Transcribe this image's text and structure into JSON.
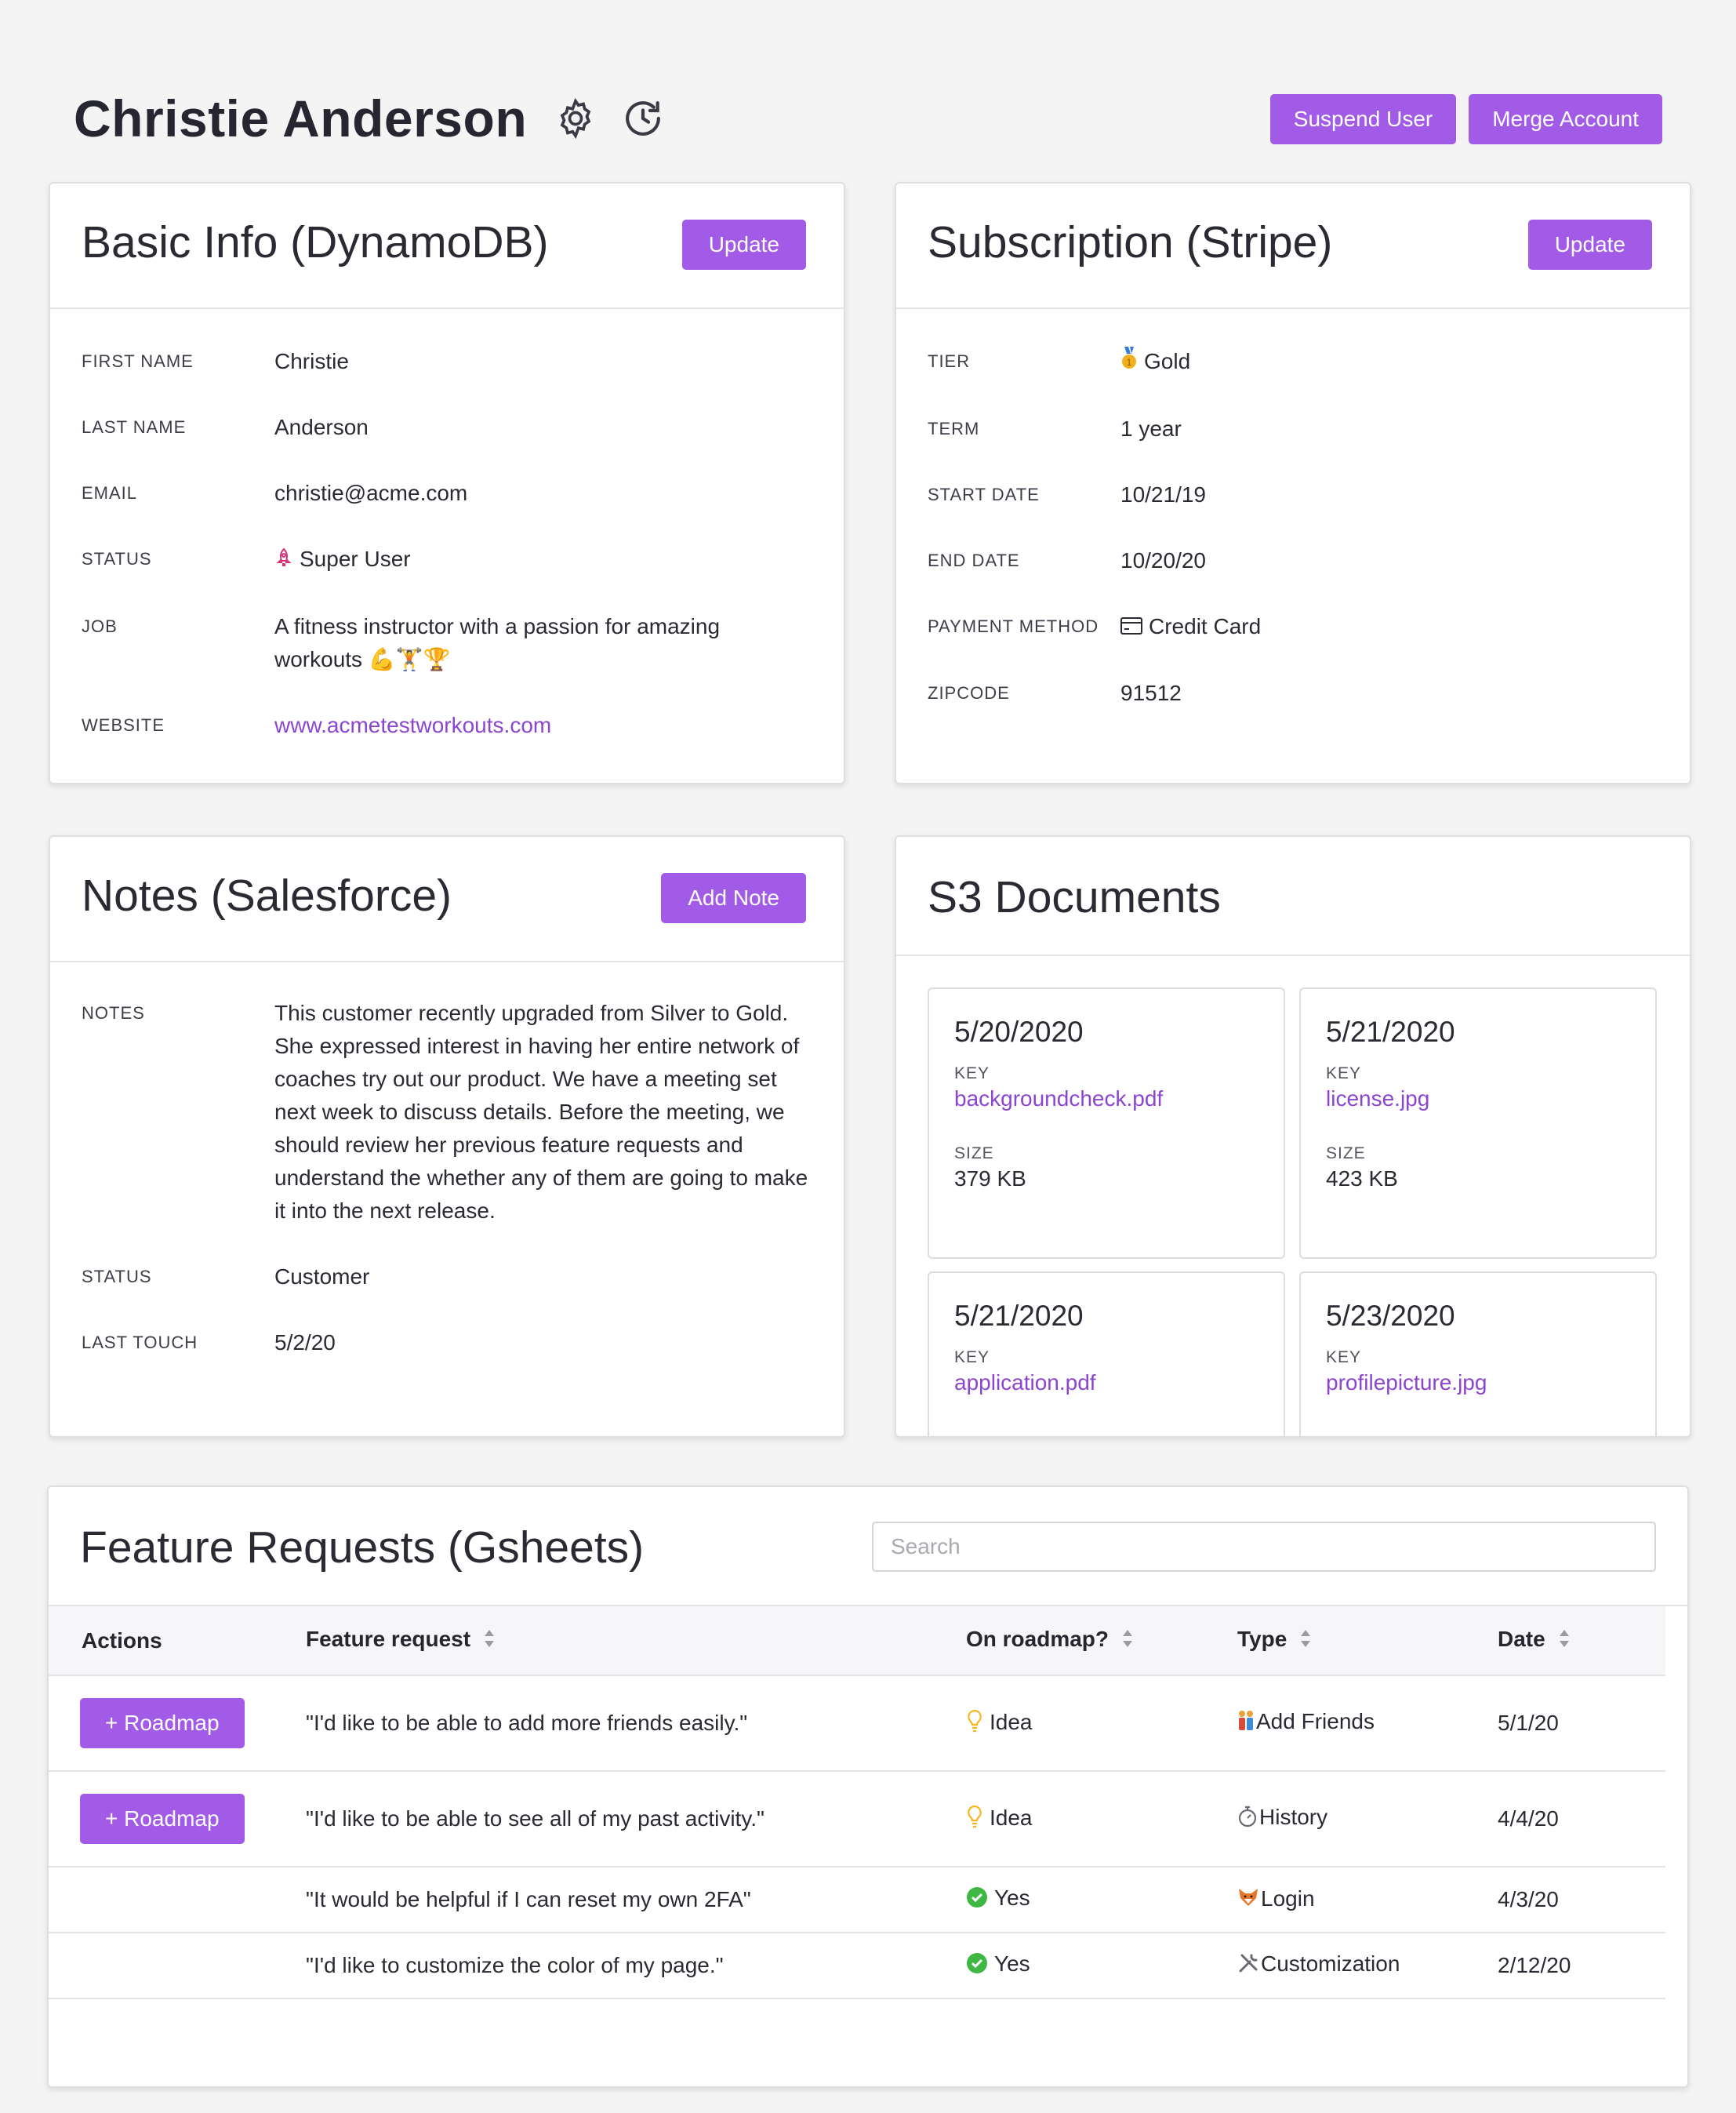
{
  "header": {
    "title": "Christie Anderson",
    "actions": {
      "suspend": "Suspend User",
      "merge": "Merge Account"
    }
  },
  "basic_info": {
    "title": "Basic Info (DynamoDB)",
    "update_label": "Update",
    "fields": {
      "first_name": {
        "label": "FIRST NAME",
        "value": "Christie"
      },
      "last_name": {
        "label": "LAST NAME",
        "value": "Anderson"
      },
      "email": {
        "label": "EMAIL",
        "value": "christie@acme.com"
      },
      "status": {
        "label": "STATUS",
        "value": "Super User",
        "icon": "rocket-icon"
      },
      "job": {
        "label": "JOB",
        "value": "A fitness instructor with a passion for amazing workouts 💪🏋️🏆"
      },
      "website": {
        "label": "WEBSITE",
        "value": "www.acmetestworkouts.com"
      }
    }
  },
  "subscription": {
    "title": "Subscription (Stripe)",
    "update_label": "Update",
    "fields": {
      "tier": {
        "label": "TIER",
        "value": "Gold",
        "icon": "gold-medal-icon"
      },
      "term": {
        "label": "TERM",
        "value": "1 year"
      },
      "start_date": {
        "label": "START DATE",
        "value": "10/21/19"
      },
      "end_date": {
        "label": "END DATE",
        "value": "10/20/20"
      },
      "payment_method": {
        "label": "PAYMENT METHOD",
        "value": "Credit Card",
        "icon": "credit-card-icon"
      },
      "zipcode": {
        "label": "ZIPCODE",
        "value": "91512"
      }
    }
  },
  "notes": {
    "title": "Notes (Salesforce)",
    "add_label": "Add Note",
    "fields": {
      "notes": {
        "label": "NOTES",
        "value": "This customer recently upgraded from Silver to Gold. She expressed interest in having her entire network of coaches try out our product. We have a meeting set next week to discuss details. Before the meeting, we should review her previous feature requests and understand the whether any of them are going to make it into the next release."
      },
      "status": {
        "label": "STATUS",
        "value": "Customer"
      },
      "last_touch": {
        "label": "LAST TOUCH",
        "value": "5/2/20"
      }
    }
  },
  "s3": {
    "title": "S3 Documents",
    "key_label": "KEY",
    "size_label": "SIZE",
    "docs": [
      {
        "date": "5/20/2020",
        "key": "backgroundcheck.pdf",
        "size": "379 KB"
      },
      {
        "date": "5/21/2020",
        "key": "license.jpg",
        "size": "423 KB"
      },
      {
        "date": "5/21/2020",
        "key": "application.pdf",
        "size": ""
      },
      {
        "date": "5/23/2020",
        "key": "profilepicture.jpg",
        "size": ""
      }
    ]
  },
  "features": {
    "title": "Feature Requests (Gsheets)",
    "search_placeholder": "Search",
    "columns": [
      "Actions",
      "Feature request",
      "On roadmap?",
      "Type",
      "Date"
    ],
    "roadmap_button": "+ Roadmap",
    "rows": [
      {
        "request": "\"I'd like to be able to add more friends easily.\"",
        "roadmap": "Idea",
        "roadmap_icon": "lightbulb-icon",
        "type": "Add Friends",
        "type_icon": "people-icon",
        "date": "5/1/20",
        "has_button": true
      },
      {
        "request": "\"I'd like to be able to see all of my past activity.\"",
        "roadmap": "Idea",
        "roadmap_icon": "lightbulb-icon",
        "type": "History",
        "type_icon": "stopwatch-icon",
        "date": "4/4/20",
        "has_button": true
      },
      {
        "request": "\"It would be helpful if I can reset my own 2FA\"",
        "roadmap": "Yes",
        "roadmap_icon": "check-circle-icon",
        "type": "Login",
        "type_icon": "fox-icon",
        "date": "4/3/20",
        "has_button": false
      },
      {
        "request": "\"I'd like to customize the color of my page.\"",
        "roadmap": "Yes",
        "roadmap_icon": "check-circle-icon",
        "type": "Customization",
        "type_icon": "tools-icon",
        "date": "2/12/20",
        "has_button": false
      }
    ]
  },
  "colors": {
    "accent": "#a15be6",
    "link": "#8c45cf",
    "yes": "#3fb843",
    "idea": "#f5b51b"
  }
}
